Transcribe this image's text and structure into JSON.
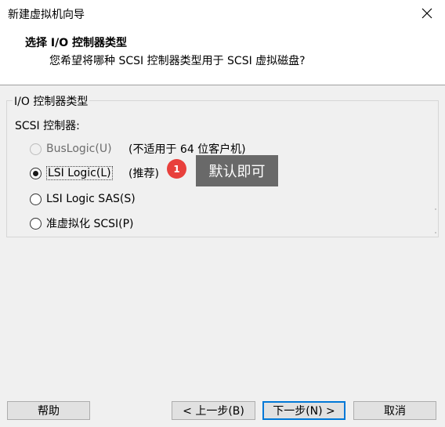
{
  "window": {
    "title": "新建虚拟机向导",
    "close_icon": "close-icon"
  },
  "header": {
    "title": "选择 I/O 控制器类型",
    "subtitle": "您希望将哪种 SCSI 控制器类型用于 SCSI 虚拟磁盘?"
  },
  "group": {
    "title": "I/O 控制器类型",
    "label": "SCSI 控制器:",
    "options": [
      {
        "label": "BusLogic(U)",
        "note": "(不适用于 64 位客户机)",
        "state": "disabled"
      },
      {
        "label": "LSI Logic(L)",
        "note": "(推荐)",
        "state": "selected"
      },
      {
        "label": "LSI Logic SAS(S)",
        "note": "",
        "state": "unselected"
      },
      {
        "label": "准虚拟化 SCSI(P)",
        "note": "",
        "state": "unselected"
      }
    ]
  },
  "annotation": {
    "badge": "1",
    "tooltip": "默认即可",
    "badge_color": "#e8403c",
    "tooltip_color": "#696969"
  },
  "buttons": {
    "help": "帮助",
    "back": "< 上一步(B)",
    "next": "下一步(N) >",
    "cancel": "取消"
  }
}
